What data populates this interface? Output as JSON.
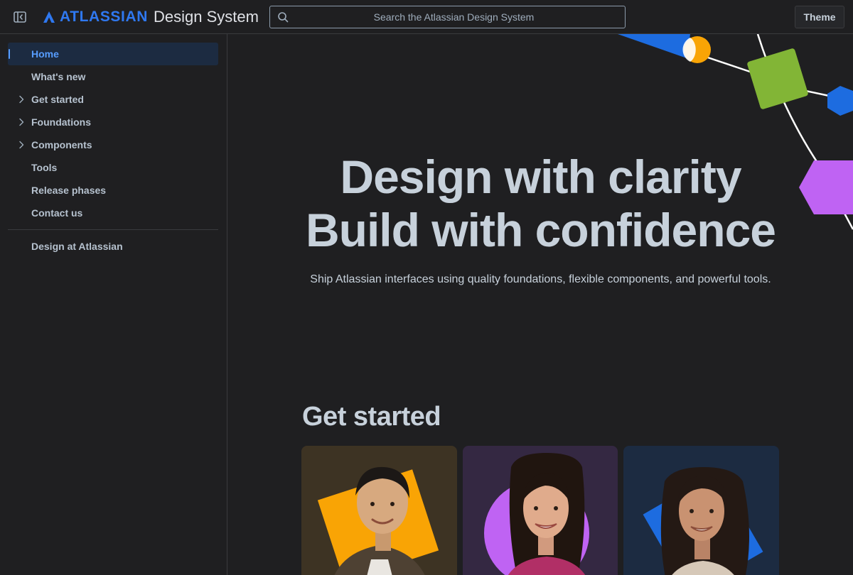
{
  "header": {
    "brand_word": "ATLASSIAN",
    "product_name": "Design System",
    "search_placeholder": "Search the Atlassian Design System",
    "theme_label": "Theme"
  },
  "sidebar": {
    "items": [
      {
        "label": "Home",
        "active": true,
        "expandable": false
      },
      {
        "label": "What's new",
        "active": false,
        "expandable": false
      },
      {
        "label": "Get started",
        "active": false,
        "expandable": true
      },
      {
        "label": "Foundations",
        "active": false,
        "expandable": true
      },
      {
        "label": "Components",
        "active": false,
        "expandable": true
      },
      {
        "label": "Tools",
        "active": false,
        "expandable": false
      },
      {
        "label": "Release phases",
        "active": false,
        "expandable": false
      },
      {
        "label": "Contact us",
        "active": false,
        "expandable": false
      }
    ],
    "extra_items": [
      {
        "label": "Design at Atlassian"
      }
    ]
  },
  "hero": {
    "title_line1": "Design with clarity",
    "title_line2": "Build with confidence",
    "subtitle": "Ship Atlassian interfaces using quality foundations, flexible components, and powerful tools."
  },
  "get_started": {
    "title": "Get started",
    "cards": [
      {
        "bg_color": "#3d3323",
        "shape": "square",
        "shape_color": "#f9a405"
      },
      {
        "bg_color": "#342842",
        "shape": "circle",
        "shape_color": "#bf63f3"
      },
      {
        "bg_color": "#1c2b41",
        "shape": "square",
        "shape_color": "#1d6ce0"
      }
    ]
  },
  "colors": {
    "accent": "#579dff",
    "brand_blue": "#2f78f0",
    "green": "#82b536",
    "purple": "#bf63f3",
    "orange": "#f9a405"
  },
  "icons": {
    "sidebar_toggle": "sidebar-collapse-icon",
    "search": "search-icon",
    "brand": "atlassian-logo-icon",
    "chevron": "chevron-right-icon"
  }
}
